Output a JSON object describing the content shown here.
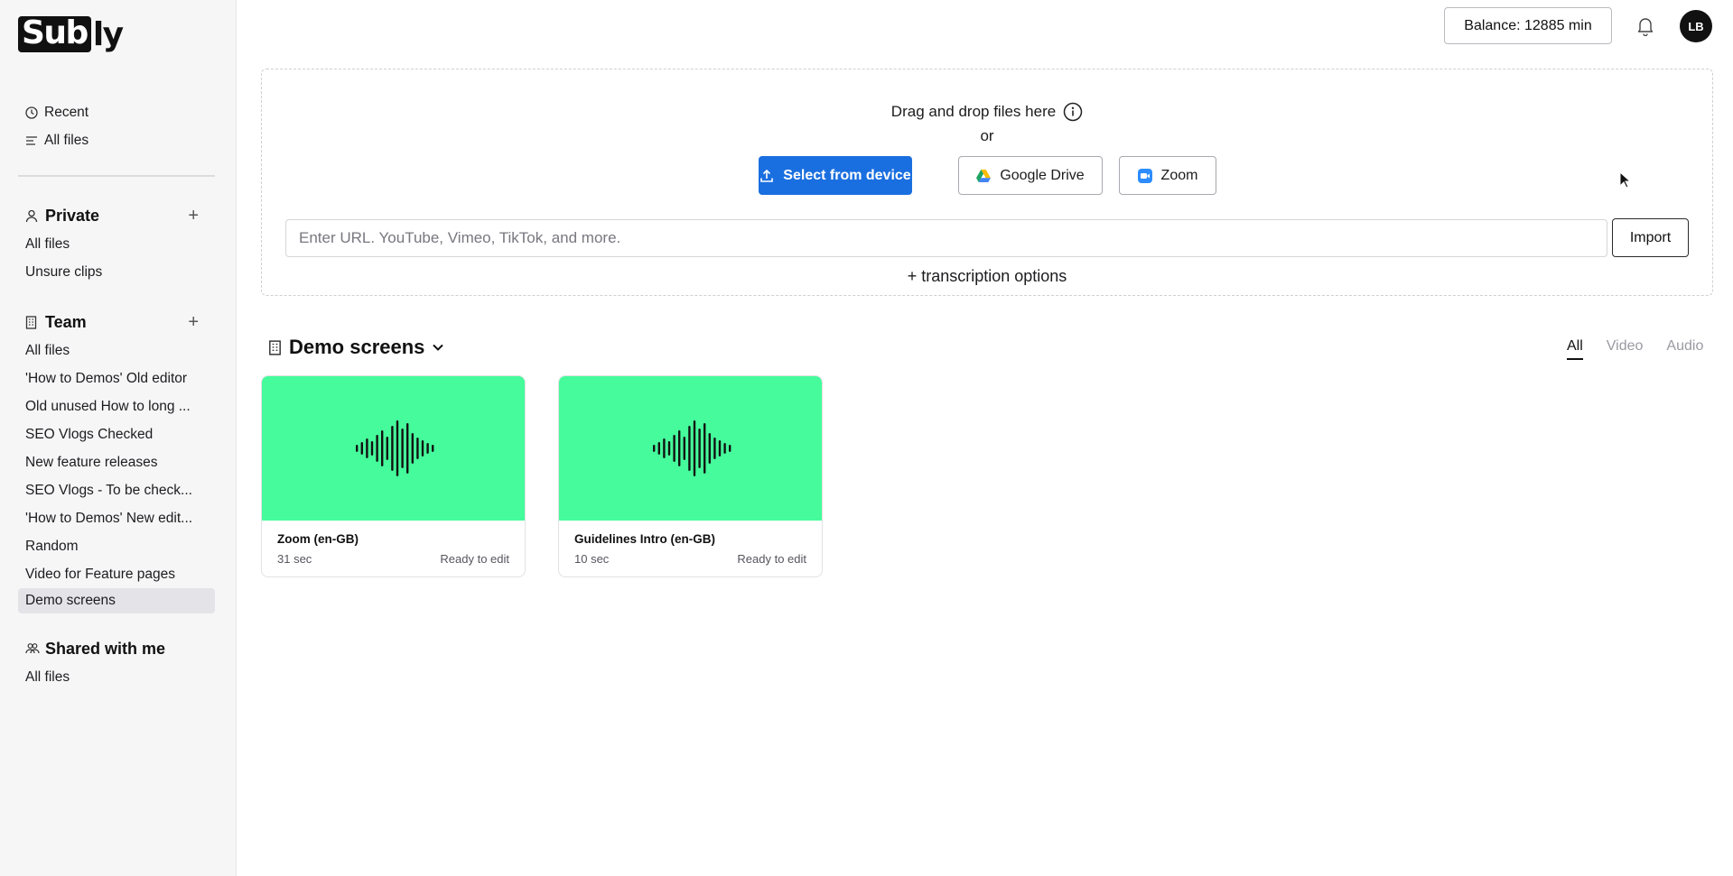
{
  "brand": {
    "logo_boxed": "Sub",
    "logo_rest": "ly"
  },
  "sidebar": {
    "top_items": [
      {
        "label": "Recent",
        "icon": "clock-icon"
      },
      {
        "label": "All files",
        "icon": "list-icon"
      }
    ],
    "private": {
      "title": "Private",
      "icon": "user-icon",
      "add": "+",
      "items": [
        "All files",
        "Unsure clips"
      ]
    },
    "team": {
      "title": "Team",
      "icon": "building-icon",
      "add": "+",
      "items": [
        "All files",
        "'How to Demos' Old editor",
        "Old unused How to long ...",
        "SEO Vlogs Checked",
        "New feature releases",
        "SEO Vlogs - To be check...",
        "'How to Demos' New edit...",
        "Random",
        "Video for Feature pages",
        "Demo screens"
      ],
      "active_item": "Demo screens"
    },
    "shared": {
      "title": "Shared with me",
      "icon": "shared-icon",
      "items": [
        "All files"
      ]
    }
  },
  "header": {
    "balance": "Balance: 12885 min",
    "bell_icon": "bell-icon",
    "avatar_initials": "LB"
  },
  "upload": {
    "title": "Drag and drop files here",
    "or": "or",
    "select_device": "Select from device",
    "google_drive": "Google Drive",
    "zoom": "Zoom",
    "url_placeholder": "Enter URL. YouTube, Vimeo, TikTok, and more.",
    "import": "Import",
    "transcription_options": "+ transcription options"
  },
  "folder": {
    "title": "Demo screens",
    "filters": [
      "All",
      "Video",
      "Audio"
    ],
    "active_filter": "All"
  },
  "files": [
    {
      "name": "Zoom (en-GB)",
      "duration": "31 sec",
      "status": "Ready to edit"
    },
    {
      "name": "Guidelines Intro (en-GB)",
      "duration": "10 sec",
      "status": "Ready to edit"
    }
  ],
  "colors": {
    "primary": "#1a6fe0",
    "thumbnail": "#45fb9b",
    "sidebar_bg": "#f6f6f7",
    "active_item_bg": "#e4e4e8"
  }
}
